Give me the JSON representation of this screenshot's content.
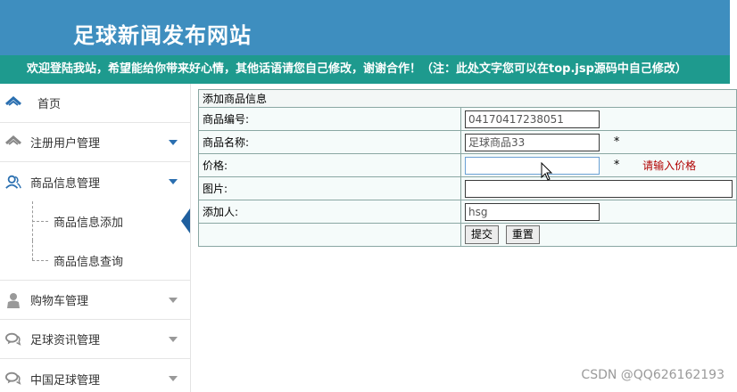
{
  "header": {
    "site_title": "足球新闻发布网站",
    "marquee_text": "欢迎登陆我站，希望能给你带来好心情，其他话语请您自己修改，谢谢合作！（注：此处文字您可以在top.jsp源码中自己修改）"
  },
  "sidebar": {
    "home": "首页",
    "users": "注册用户管理",
    "products": "商品信息管理",
    "product_add": "商品信息添加",
    "product_query": "商品信息查询",
    "cart": "购物车管理",
    "news": "足球资讯管理",
    "china_football": "中国足球管理"
  },
  "form": {
    "title": "添加商品信息",
    "id_label": "商品编号:",
    "id_value": "04170417238051",
    "name_label": "商品名称:",
    "name_value": "足球商品33",
    "price_label": "价格:",
    "price_value": "",
    "price_error": "请输入价格",
    "image_label": "图片:",
    "image_value": "",
    "adder_label": "添加人:",
    "adder_value": "hsg",
    "required_mark": "*",
    "submit": "提交",
    "reset": "重置"
  },
  "watermark": "CSDN @QQ626162193",
  "colors": {
    "header": "#3e8ebf",
    "marquee": "#1e9a8e",
    "active_pointer": "#1f5f9e",
    "error": "#b00000"
  }
}
